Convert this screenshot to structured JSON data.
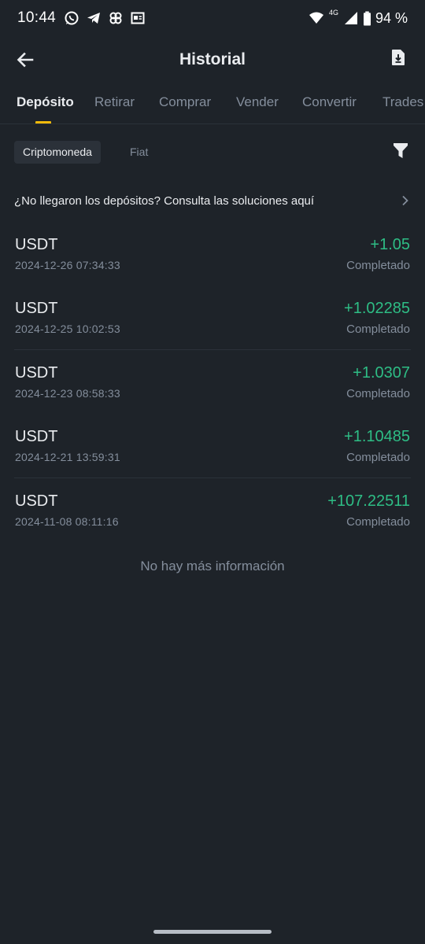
{
  "status_bar": {
    "time": "10:44",
    "network": "4G",
    "battery": "94 %",
    "left_icons": [
      "whatsapp-icon",
      "telegram-icon",
      "pinwheel-icon",
      "news-icon"
    ],
    "right_icons": [
      "wifi-icon",
      "signal-icon",
      "battery-icon"
    ]
  },
  "header": {
    "title": "Historial",
    "back_icon": "arrow-left-icon",
    "export_icon": "file-download-icon"
  },
  "tabs": [
    {
      "label": "Depósito",
      "active": true
    },
    {
      "label": "Retirar",
      "active": false
    },
    {
      "label": "Comprar",
      "active": false
    },
    {
      "label": "Vender",
      "active": false
    },
    {
      "label": "Convertir",
      "active": false
    },
    {
      "label": "Trades",
      "active": false
    }
  ],
  "filters": {
    "active": "Criptomoneda",
    "inactive": "Fiat",
    "filter_icon": "funnel-icon"
  },
  "notice": {
    "text": "¿No llegaron los depósitos? Consulta las soluciones aquí",
    "icon": "chevron-right-icon"
  },
  "deposits": [
    {
      "coin": "USDT",
      "date": "2024-12-26 07:34:33",
      "amount": "+1.05",
      "status": "Completado"
    },
    {
      "coin": "USDT",
      "date": "2024-12-25 10:02:53",
      "amount": "+1.02285",
      "status": "Completado"
    },
    {
      "coin": "USDT",
      "date": "2024-12-23 08:58:33",
      "amount": "+1.0307",
      "status": "Completado"
    },
    {
      "coin": "USDT",
      "date": "2024-12-21 13:59:31",
      "amount": "+1.10485",
      "status": "Completado"
    },
    {
      "coin": "USDT",
      "date": "2024-11-08 08:11:16",
      "amount": "+107.22511",
      "status": "Completado"
    }
  ],
  "footer": {
    "no_more": "No hay más información"
  },
  "colors": {
    "background": "#1e2329",
    "accent": "#f0b90b",
    "positive": "#2ebd85",
    "muted": "#848e9c",
    "text": "#eaecef"
  }
}
